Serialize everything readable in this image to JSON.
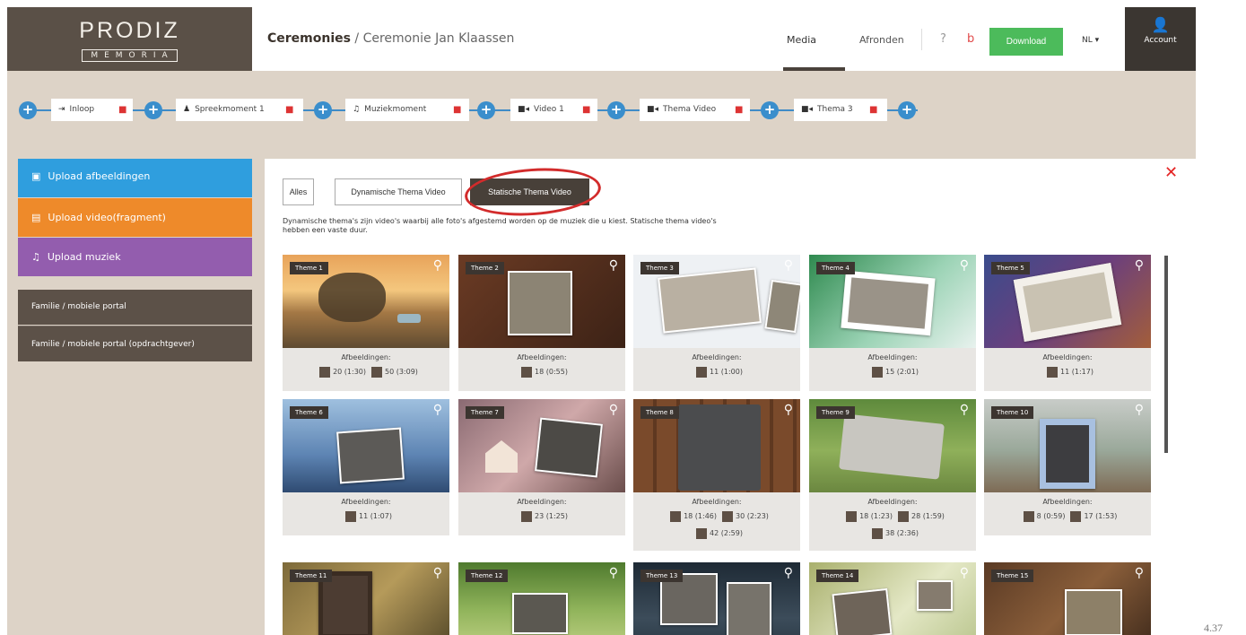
{
  "logo": {
    "name": "PRODIZ",
    "sub": "MEMORIA"
  },
  "breadcrumb": {
    "section": "Ceremonies",
    "separator": "/",
    "current": "Ceremonie Jan Klaassen"
  },
  "nav": {
    "media": "Media",
    "afronden": "Afronden",
    "download": "Download",
    "lang": "NL ▾",
    "account": "Account"
  },
  "icons": {
    "help": "help-icon",
    "clip": "attachment-icon",
    "account": "user-icon"
  },
  "timeline": {
    "items": [
      {
        "label": "Inloop",
        "icon": "login-icon"
      },
      {
        "label": "Spreekmoment 1",
        "icon": "person-icon"
      },
      {
        "label": "Muziekmoment",
        "icon": "music-icon"
      },
      {
        "label": "Video 1",
        "icon": "video-icon"
      },
      {
        "label": "Thema Video",
        "icon": "video-icon"
      },
      {
        "label": "Thema 3",
        "icon": "video-icon"
      }
    ]
  },
  "sidebar": {
    "upload_images": "Upload afbeeldingen",
    "upload_video": "Upload video(fragment)",
    "upload_music": "Upload muziek",
    "portal": "Familie / mobiele portal",
    "portal_client": "Familie / mobiele portal (opdrachtgever)"
  },
  "filters": {
    "all": "Alles",
    "dynamic": "Dynamische Thema Video",
    "static": "Statische Thema Video"
  },
  "description": "Dynamische thema's zijn video's waarbij alle foto's afgestemd worden op de muziek die u kiest. Statische thema video's hebben een vaste duur.",
  "images_label": "Afbeeldingen:",
  "themes": [
    {
      "name": "Theme 1",
      "options": [
        "20 (1:30)",
        "50 (3:09)"
      ]
    },
    {
      "name": "Theme 2",
      "options": [
        "18 (0:55)"
      ]
    },
    {
      "name": "Theme 3",
      "options": [
        "11 (1:00)"
      ]
    },
    {
      "name": "Theme 4",
      "options": [
        "15 (2:01)"
      ]
    },
    {
      "name": "Theme 5",
      "options": [
        "11 (1:17)"
      ]
    },
    {
      "name": "Theme 6",
      "options": [
        "11 (1:07)"
      ]
    },
    {
      "name": "Theme 7",
      "options": [
        "23 (1:25)"
      ]
    },
    {
      "name": "Theme 8",
      "options": [
        "18 (1:46)",
        "30 (2:23)",
        "42 (2:59)"
      ]
    },
    {
      "name": "Theme 9",
      "options": [
        "18 (1:23)",
        "28 (1:59)",
        "38 (2:36)"
      ]
    },
    {
      "name": "Theme 10",
      "options": [
        "8 (0:59)",
        "17 (1:53)"
      ]
    },
    {
      "name": "Theme 11",
      "options": []
    },
    {
      "name": "Theme 12",
      "options": []
    },
    {
      "name": "Theme 13",
      "options": []
    },
    {
      "name": "Theme 14",
      "options": []
    },
    {
      "name": "Theme 15",
      "options": []
    }
  ],
  "page_number": "4.37",
  "colors": {
    "blue": "#2f9ede",
    "orange": "#ee8a2a",
    "purple": "#935dae",
    "green": "#4cbb5b",
    "dark": "#5a5047",
    "red": "#e42424"
  }
}
